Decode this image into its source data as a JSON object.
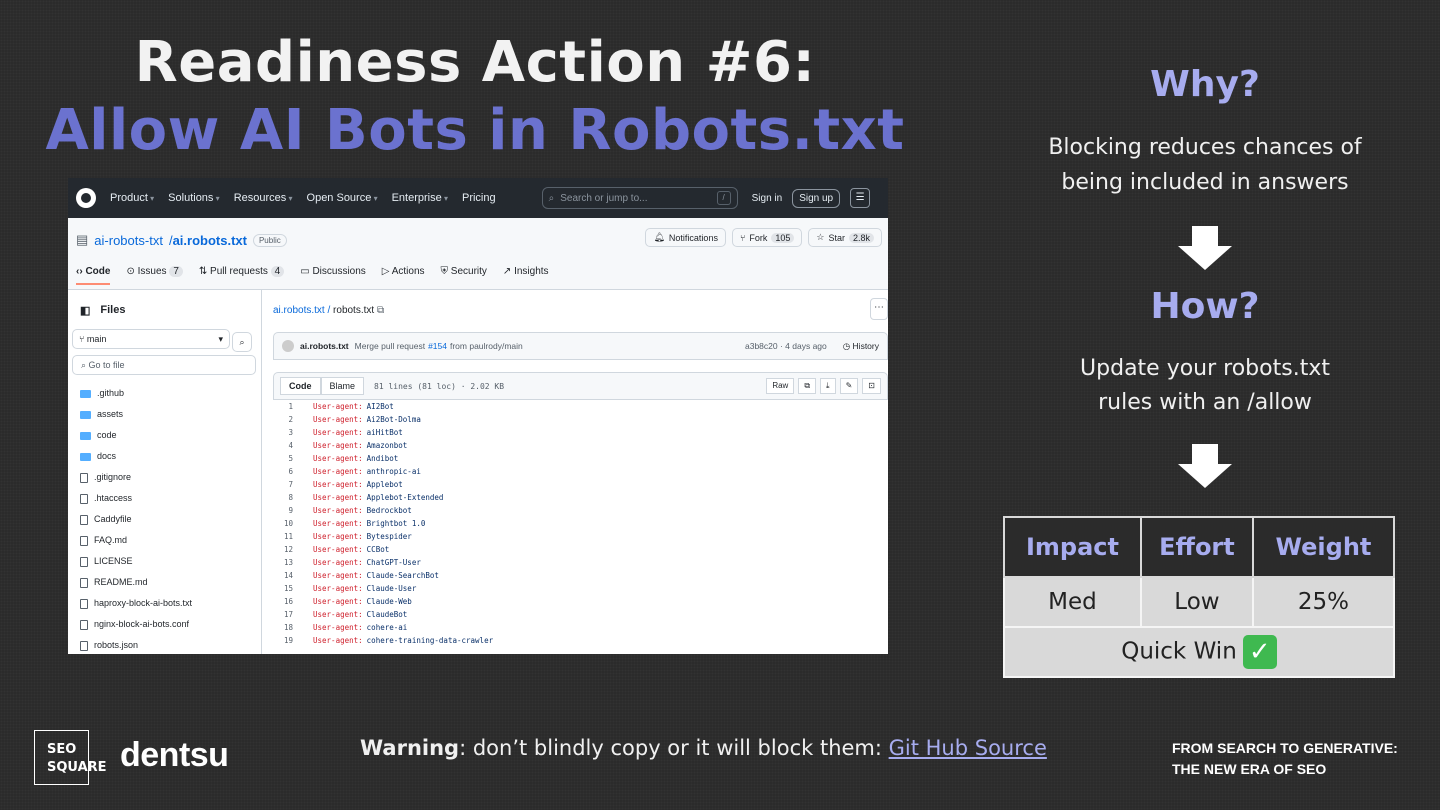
{
  "title": {
    "line1": "Readiness Action #6:",
    "line2": "Allow AI Bots in Robots.txt"
  },
  "colors": {
    "accent": "#6b72cf",
    "accent_light": "#a7acef",
    "background": "#2b2b2b"
  },
  "github": {
    "nav": [
      "Product",
      "Solutions",
      "Resources",
      "Open Source",
      "Enterprise",
      "Pricing"
    ],
    "search_placeholder": "Search or jump to...",
    "slash_key": "/",
    "sign_in": "Sign in",
    "sign_up": "Sign up",
    "repo_owner": "ai-robots-txt",
    "repo_sep": " / ",
    "repo_name": "ai.robots.txt",
    "visibility": "Public",
    "notifications": "Notifications",
    "fork": "Fork",
    "fork_count": "105",
    "star": "Star",
    "star_count": "2.8k",
    "tabs": [
      {
        "label": "Code"
      },
      {
        "label": "Issues",
        "count": "7"
      },
      {
        "label": "Pull requests",
        "count": "4"
      },
      {
        "label": "Discussions"
      },
      {
        "label": "Actions"
      },
      {
        "label": "Security"
      },
      {
        "label": "Insights"
      }
    ],
    "files_label": "Files",
    "branch": "main",
    "goto_placeholder": "Go to file",
    "tree": [
      {
        "name": ".github",
        "type": "folder"
      },
      {
        "name": "assets",
        "type": "folder"
      },
      {
        "name": "code",
        "type": "folder"
      },
      {
        "name": "docs",
        "type": "folder"
      },
      {
        "name": ".gitignore",
        "type": "file"
      },
      {
        "name": ".htaccess",
        "type": "file"
      },
      {
        "name": "Caddyfile",
        "type": "file"
      },
      {
        "name": "FAQ.md",
        "type": "file"
      },
      {
        "name": "LICENSE",
        "type": "file"
      },
      {
        "name": "README.md",
        "type": "file"
      },
      {
        "name": "haproxy-block-ai-bots.txt",
        "type": "file"
      },
      {
        "name": "nginx-block-ai-bots.conf",
        "type": "file"
      },
      {
        "name": "robots.json",
        "type": "file"
      }
    ],
    "breadcrumb_repo": "ai.robots.txt",
    "breadcrumb_file": "robots.txt",
    "commit_author": "ai.robots.txt",
    "commit_msg": "Merge pull request",
    "commit_pr": "#154",
    "commit_from": "from paulrody/main",
    "commit_hash": "a3b8c20 · 4 days ago",
    "history": "History",
    "code_tab": "Code",
    "blame_tab": "Blame",
    "file_meta": "81 lines (81 loc) · 2.02 KB",
    "raw": "Raw",
    "code_key": "User-agent:",
    "agents": [
      "AI2Bot",
      "Ai2Bot-Dolma",
      "aiHitBot",
      "Amazonbot",
      "Andibot",
      "anthropic-ai",
      "Applebot",
      "Applebot-Extended",
      "Bedrockbot",
      "Brightbot 1.0",
      "Bytespider",
      "CCBot",
      "ChatGPT-User",
      "Claude-SearchBot",
      "Claude-User",
      "Claude-Web",
      "ClaudeBot",
      "cohere-ai",
      "cohere-training-data-crawler"
    ]
  },
  "why": {
    "heading": "Why?",
    "line1": "Blocking reduces chances of",
    "line2": "being included in answers"
  },
  "how": {
    "heading": "How?",
    "line1": "Update your robots.txt",
    "line2": "rules with an /allow"
  },
  "table": {
    "headers": [
      "Impact",
      "Effort",
      "Weight"
    ],
    "values": [
      "Med",
      "Low",
      "25%"
    ],
    "footer": "Quick Win",
    "check": "✓"
  },
  "footer": {
    "logo_line1": "SEO",
    "logo_line2": "SQUARE",
    "brand": "dentsu",
    "warning_bold": "Warning",
    "warning_text": ": don’t blindly copy or it will block them: ",
    "link": "Git Hub Source",
    "tagline1": "FROM SEARCH TO GENERATIVE:",
    "tagline2": "THE NEW ERA OF SEO"
  }
}
